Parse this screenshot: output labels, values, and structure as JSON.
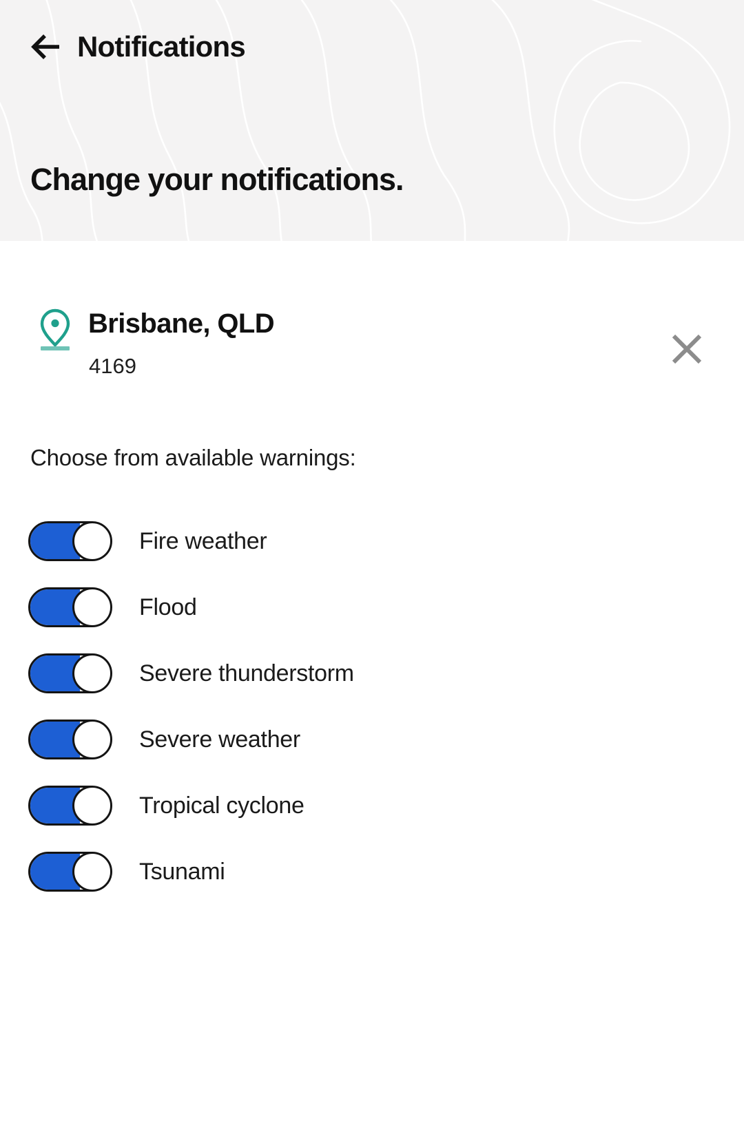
{
  "header": {
    "back_icon": "back-arrow-icon",
    "nav_title": "Notifications",
    "page_heading": "Change your notifications.",
    "background_color": "#f4f3f3"
  },
  "location": {
    "pin_icon": "location-pin-icon",
    "name": "Brisbane, QLD",
    "postcode": "4169",
    "remove_icon": "close-icon",
    "pin_color": "#1fa08c",
    "remove_icon_color": "#8c8c8c"
  },
  "warnings": {
    "section_label": "Choose from available warnings:",
    "accent_color": "#1d5fd4",
    "items": [
      {
        "label": "Fire weather",
        "enabled": true
      },
      {
        "label": "Flood",
        "enabled": true
      },
      {
        "label": "Severe thunderstorm",
        "enabled": true
      },
      {
        "label": "Severe weather",
        "enabled": true
      },
      {
        "label": "Tropical cyclone",
        "enabled": true
      },
      {
        "label": "Tsunami",
        "enabled": true
      }
    ]
  }
}
